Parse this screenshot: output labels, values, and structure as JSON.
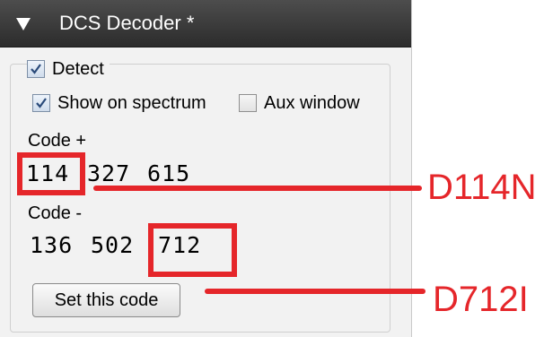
{
  "panel": {
    "title": "DCS Decoder *",
    "collapse_icon": "triangle-down-icon"
  },
  "options": {
    "detect": {
      "label": "Detect",
      "checked": true
    },
    "show_on_spectrum": {
      "label": "Show on spectrum",
      "checked": true
    },
    "aux_window": {
      "label": "Aux window",
      "checked": false
    }
  },
  "code_plus": {
    "label": "Code +",
    "values": [
      "114",
      "327",
      "615"
    ]
  },
  "code_minus": {
    "label": "Code -",
    "values": [
      "136",
      "502",
      "712"
    ]
  },
  "set_button": {
    "label": "Set this code"
  },
  "annotations": {
    "color": "#e5262a",
    "plus_note": "D114N",
    "minus_note": "D712I"
  }
}
